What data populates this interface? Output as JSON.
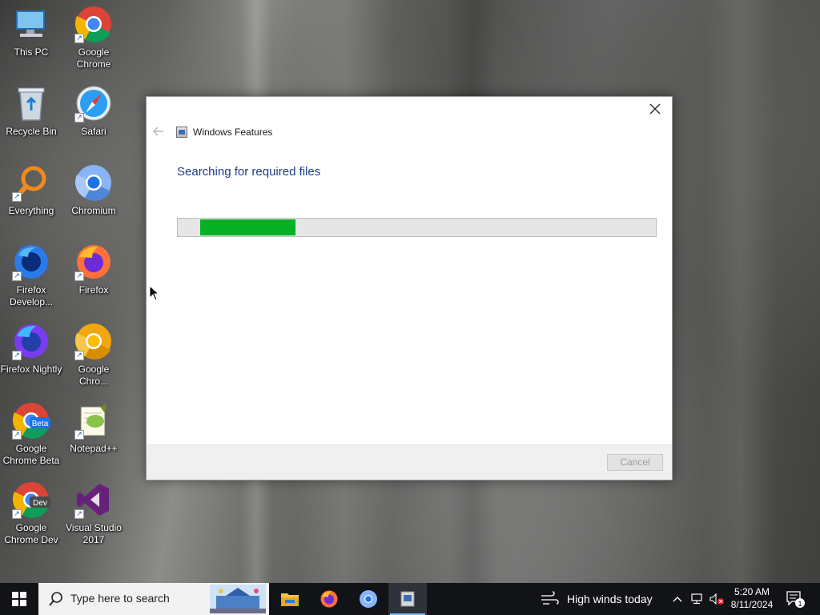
{
  "desktop": {
    "icons": [
      {
        "label": "This PC",
        "icon": "this-pc-icon"
      },
      {
        "label": "Google Chrome",
        "icon": "chrome-icon"
      },
      {
        "label": "Recycle Bin",
        "icon": "recycle-bin-icon"
      },
      {
        "label": "Safari",
        "icon": "safari-icon"
      },
      {
        "label": "Everything",
        "icon": "everything-icon"
      },
      {
        "label": "Chromium",
        "icon": "chromium-icon"
      },
      {
        "label": "Firefox Develop...",
        "icon": "firefox-developer-icon"
      },
      {
        "label": "Firefox",
        "icon": "firefox-icon"
      },
      {
        "label": "Firefox Nightly",
        "icon": "firefox-nightly-icon"
      },
      {
        "label": "Google Chro...",
        "icon": "chrome-canary-icon"
      },
      {
        "label": "Google Chrome Beta",
        "icon": "chrome-beta-icon"
      },
      {
        "label": "Notepad++",
        "icon": "notepad-plus-plus-icon"
      },
      {
        "label": "Google Chrome Dev",
        "icon": "chrome-dev-icon"
      },
      {
        "label": "Visual Studio 2017",
        "icon": "visual-studio-icon"
      }
    ],
    "badges": {
      "beta": "Beta",
      "dev": "Dev"
    }
  },
  "dialog": {
    "title": "Windows Features",
    "heading": "Searching for required files",
    "progress_fraction": 0.21,
    "cancel_label": "Cancel",
    "progress_color": "#06b025"
  },
  "taskbar": {
    "search_placeholder": "Type here to search",
    "weather_text": "High winds today",
    "time": "5:20 AM",
    "date": "8/11/2024",
    "notification_count": "1",
    "pinned": [
      "file-explorer-icon",
      "firefox-icon",
      "chromium-icon",
      "windows-features-icon"
    ],
    "accent_color": "#76b9ed"
  }
}
